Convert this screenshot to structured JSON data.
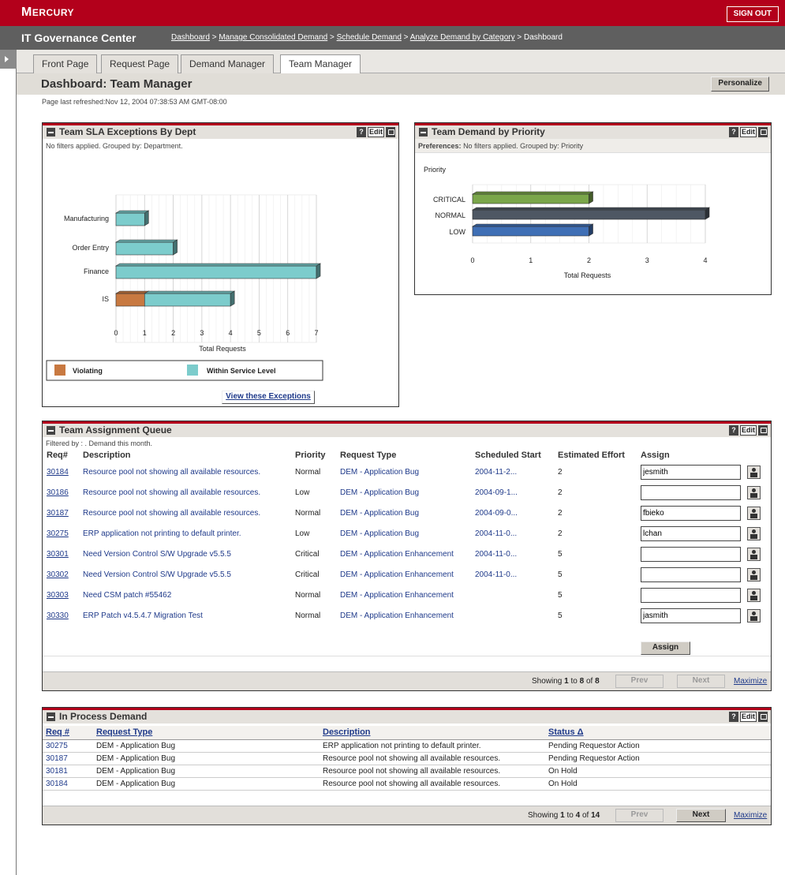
{
  "brand": {
    "logo_text": "Mercury",
    "signout_label": "SIGN OUT"
  },
  "nav": {
    "app_title": "IT Governance Center",
    "breadcrumb": [
      "Dashboard",
      "Manage Consolidated Demand",
      "Schedule Demand",
      "Analyze Demand by Category",
      "Dashboard"
    ],
    "sep": ">"
  },
  "tabs": [
    {
      "label": "Front Page"
    },
    {
      "label": "Request Page"
    },
    {
      "label": "Demand Manager"
    },
    {
      "label": "Team Manager"
    }
  ],
  "page": {
    "title": "Dashboard: Team Manager",
    "personalize_label": "Personalize",
    "refreshed": "Page last refreshed:Nov 12, 2004 07:38:53 AM GMT-08:00"
  },
  "icons": {
    "help": "help-icon",
    "edit": "Edit",
    "maximize": "maximize-icon",
    "minimize": "minimize-icon",
    "person": "person-lookup-icon"
  },
  "colors": {
    "brand": "#b3001b",
    "violating": "#c87941",
    "within": "#7ccccc",
    "critical": "#7aa64a",
    "normal": "#4e5763",
    "low": "#3f6fb5"
  },
  "sla": {
    "title": "Team SLA Exceptions By Dept",
    "subtitle": "No filters applied. Grouped by: Department.",
    "button": "View these Exceptions",
    "legend": [
      "Violating",
      "Within Service Level"
    ],
    "chart_data": {
      "type": "bar",
      "orientation": "horizontal",
      "stacked": true,
      "categories": [
        "Manufacturing",
        "Order Entry",
        "Finance",
        "IS"
      ],
      "series": [
        {
          "name": "Violating",
          "values": [
            0,
            0,
            0,
            1
          ]
        },
        {
          "name": "Within Service Level",
          "values": [
            1,
            2,
            7,
            3
          ]
        }
      ],
      "xlabel": "Total Requests",
      "xlim": [
        0,
        7
      ],
      "xticks": [
        "0",
        "1",
        "2",
        "3",
        "4",
        "5",
        "6",
        "7"
      ],
      "grid": true,
      "legend_position": "bottom"
    }
  },
  "priority": {
    "title": "Team Demand by Priority",
    "subtitle_bold": "Preferences:",
    "subtitle": "No filters applied. Grouped by: Priority",
    "chart_data": {
      "type": "bar",
      "orientation": "horizontal",
      "categories": [
        "CRITICAL",
        "NORMAL",
        "LOW"
      ],
      "values": [
        2,
        4,
        2
      ],
      "ylabel": "Priority",
      "xlabel": "Total Requests",
      "xlim": [
        0,
        4
      ],
      "xticks": [
        "0",
        "1",
        "2",
        "3",
        "4"
      ],
      "grid": true
    }
  },
  "queue": {
    "title": "Team Assignment Queue",
    "filter": "Filtered by : . Demand this month.",
    "columns": [
      "Req#",
      "Description",
      "Priority",
      "Request Type",
      "Scheduled Start",
      "Estimated Effort",
      "Assign"
    ],
    "rows": [
      {
        "req": "30184",
        "desc": "Resource pool not showing all available resources.",
        "priority": "Normal",
        "type": "DEM - Application Bug",
        "start": "2004-11-2...",
        "effort": "2",
        "assign": "jesmith"
      },
      {
        "req": "30186",
        "desc": "Resource pool not showing all available resources.",
        "priority": "Low",
        "type": "DEM - Application Bug",
        "start": "2004-09-1...",
        "effort": "2",
        "assign": ""
      },
      {
        "req": "30187",
        "desc": "Resource pool not showing all available resources.",
        "priority": "Normal",
        "type": "DEM - Application Bug",
        "start": "2004-09-0...",
        "effort": "2",
        "assign": "fbieko"
      },
      {
        "req": "30275",
        "desc": "ERP application not printing to default printer.",
        "priority": "Low",
        "type": "DEM - Application Bug",
        "start": "2004-11-0...",
        "effort": "2",
        "assign": "lchan"
      },
      {
        "req": "30301",
        "desc": "Need Version Control S/W Upgrade v5.5.5",
        "priority": "Critical",
        "type": "DEM - Application Enhancement",
        "start": "2004-11-0...",
        "effort": "5",
        "assign": ""
      },
      {
        "req": "30302",
        "desc": "Need Version Control S/W Upgrade v5.5.5",
        "priority": "Critical",
        "type": "DEM - Application Enhancement",
        "start": "2004-11-0...",
        "effort": "5",
        "assign": ""
      },
      {
        "req": "30303",
        "desc": "Need CSM patch #55462",
        "priority": "Normal",
        "type": "DEM - Application Enhancement",
        "start": "",
        "effort": "5",
        "assign": ""
      },
      {
        "req": "30330",
        "desc": "ERP Patch v4.5.4.7 Migration Test",
        "priority": "Normal",
        "type": "DEM - Application Enhancement",
        "start": "",
        "effort": "5",
        "assign": "jasmith"
      }
    ],
    "assign_button": "Assign",
    "showing_prefix": "Showing ",
    "showing_from": "1",
    "showing_to_word": " to ",
    "showing_to": "8",
    "showing_of_word": " of ",
    "showing_total": "8",
    "prev": "Prev",
    "next": "Next",
    "maximize": "Maximize"
  },
  "inprocess": {
    "title": "In Process Demand",
    "columns": [
      "Req #",
      "Request Type",
      "Description",
      "Status Δ"
    ],
    "rows": [
      {
        "req": "30275",
        "type": "DEM - Application Bug",
        "desc": "ERP application not printing to default printer.",
        "status": "Pending Requestor Action"
      },
      {
        "req": "30187",
        "type": "DEM - Application Bug",
        "desc": "Resource pool not showing all available resources.",
        "status": "Pending Requestor Action"
      },
      {
        "req": "30181",
        "type": "DEM - Application Bug",
        "desc": "Resource pool not showing all available resources.",
        "status": "On Hold"
      },
      {
        "req": "30184",
        "type": "DEM - Application Bug",
        "desc": "Resource pool not showing all available resources.",
        "status": "On Hold"
      }
    ],
    "showing_prefix": "Showing ",
    "showing_from": "1",
    "showing_to_word": " to ",
    "showing_to": "4",
    "showing_of_word": " of ",
    "showing_total": "14",
    "prev": "Prev",
    "next": "Next",
    "maximize": "Maximize"
  }
}
